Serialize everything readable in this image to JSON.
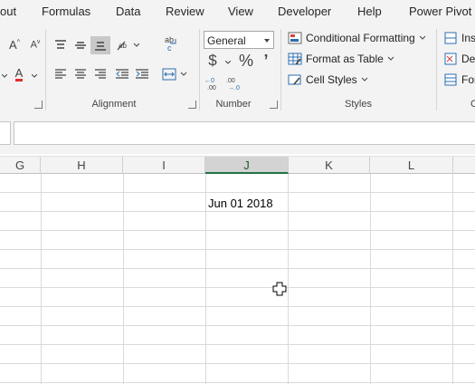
{
  "tabs": [
    "out",
    "Formulas",
    "Data",
    "Review",
    "View",
    "Developer",
    "Help",
    "Power Pivot"
  ],
  "groups": {
    "alignment": "Alignment",
    "number": "Number",
    "styles": "Styles",
    "cells_partial": "C"
  },
  "number": {
    "format_value": "General",
    "currency_symbol": "$",
    "percent_symbol": "%",
    "comma_symbol": "’"
  },
  "font_partial": {
    "grow": "A",
    "shrink": "A",
    "font_color": "A"
  },
  "styles": {
    "conditional_formatting": "Conditional Formatting",
    "format_as_table": "Format as Table",
    "cell_styles": "Cell Styles"
  },
  "cells_partial": {
    "insert": "Ins",
    "delete": "De",
    "format": "For"
  },
  "columns": [
    "G",
    "H",
    "I",
    "J",
    "K",
    "L"
  ],
  "active_column": "J",
  "cell_value": "Jun 01 2018",
  "colors": {
    "ribbon_bg": "#f3f3f3",
    "font_color_underline": "#e03030",
    "accent_green": "#217346"
  }
}
